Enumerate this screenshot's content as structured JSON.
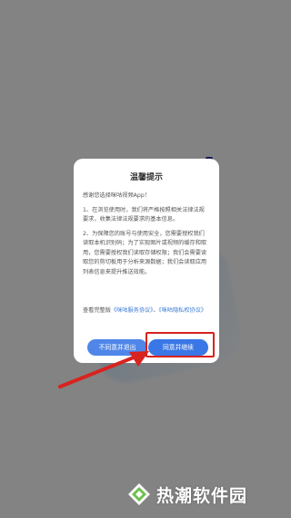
{
  "dialog": {
    "title": "温馨提示",
    "paragraphs": [
      "感谢您选择咪咕视频App！",
      "1、在浏览使用时，我们将严格按照相关法律法规要求，收集法律法规要求的基本信息。",
      "2、为保障您的账号与使用安全，您需要授权我们读取本机识别码；为了实现图片或视频的缓存和取用，您需要授权我们读取存储权限；我们会需要读取您的剪切板用于分析来源数据；我们会读取应用列表信息来提升推送效能。"
    ],
    "links_prefix": "查看完整版",
    "link_service": "《咪咕服务协议》",
    "links_sep": "、",
    "link_privacy": "《咪咕隐私权协议》",
    "decline_label": "不同意并退出",
    "accept_label": "同意并继续"
  },
  "watermark": {
    "text": "热潮软件园"
  },
  "colors": {
    "primary_button": "#3a77e6",
    "link": "#3a7bd5",
    "highlight": "#d8231f",
    "watermark_green": "#6cc04a"
  }
}
